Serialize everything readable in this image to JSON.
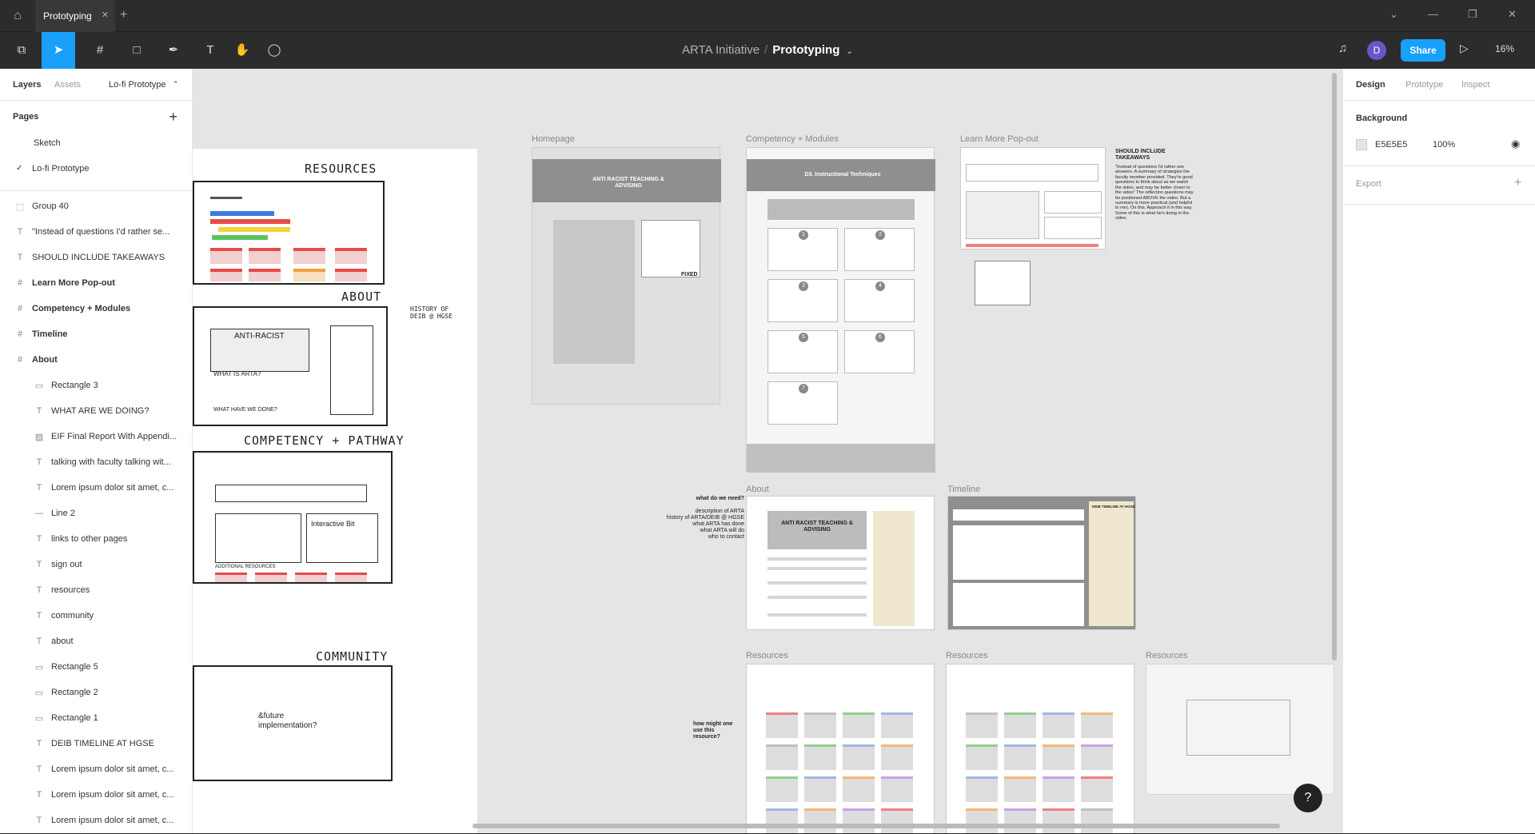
{
  "titlebar": {
    "tab_label": "Prototyping"
  },
  "toolbar": {
    "project": "ARTA Initiative",
    "separator": "/",
    "page": "Prototyping",
    "avatar_initial": "D",
    "share_label": "Share",
    "zoom": "16%"
  },
  "left": {
    "tabs": [
      "Layers",
      "Assets",
      "Lo-fi Prototype"
    ],
    "pages_title": "Pages",
    "pages": [
      "Sketch",
      "Lo-fi Prototype"
    ],
    "layers": [
      {
        "label": "Group 40",
        "icon": "group-icon",
        "glyph": "⬚",
        "child": false,
        "bold": false
      },
      {
        "label": "\"Instead of questions I'd rather se...",
        "icon": "text-icon",
        "glyph": "T",
        "child": false,
        "bold": false
      },
      {
        "label": "SHOULD INCLUDE TAKEAWAYS",
        "icon": "text-icon",
        "glyph": "T",
        "child": false,
        "bold": false
      },
      {
        "label": "Learn More Pop-out",
        "icon": "frame-icon",
        "glyph": "#",
        "child": false,
        "bold": true
      },
      {
        "label": "Competency + Modules",
        "icon": "frame-icon",
        "glyph": "#",
        "child": false,
        "bold": true
      },
      {
        "label": "Timeline",
        "icon": "frame-icon",
        "glyph": "#",
        "child": false,
        "bold": true
      },
      {
        "label": "About",
        "icon": "frame-icon",
        "glyph": "#",
        "child": false,
        "bold": true
      },
      {
        "label": "Rectangle 3",
        "icon": "rectangle-icon",
        "glyph": "▭",
        "child": true,
        "bold": false
      },
      {
        "label": "WHAT ARE WE DOING?",
        "icon": "text-icon",
        "glyph": "T",
        "child": true,
        "bold": false
      },
      {
        "label": "EIF Final Report With Appendi...",
        "icon": "image-icon",
        "glyph": "▨",
        "child": true,
        "bold": false
      },
      {
        "label": "talking with faculty talking wit...",
        "icon": "text-icon",
        "glyph": "T",
        "child": true,
        "bold": false
      },
      {
        "label": "Lorem ipsum dolor sit amet, c...",
        "icon": "text-icon",
        "glyph": "T",
        "child": true,
        "bold": false
      },
      {
        "label": "Line 2",
        "icon": "line-icon",
        "glyph": "—",
        "child": true,
        "bold": false
      },
      {
        "label": "links to other pages",
        "icon": "text-icon",
        "glyph": "T",
        "child": true,
        "bold": false
      },
      {
        "label": "sign out",
        "icon": "text-icon",
        "glyph": "T",
        "child": true,
        "bold": false
      },
      {
        "label": "resources",
        "icon": "text-icon",
        "glyph": "T",
        "child": true,
        "bold": false
      },
      {
        "label": "community",
        "icon": "text-icon",
        "glyph": "T",
        "child": true,
        "bold": false
      },
      {
        "label": "about",
        "icon": "text-icon",
        "glyph": "T",
        "child": true,
        "bold": false
      },
      {
        "label": "Rectangle 5",
        "icon": "rectangle-icon",
        "glyph": "▭",
        "child": true,
        "bold": false
      },
      {
        "label": "Rectangle 2",
        "icon": "rectangle-icon",
        "glyph": "▭",
        "child": true,
        "bold": false
      },
      {
        "label": "Rectangle 1",
        "icon": "rectangle-icon",
        "glyph": "▭",
        "child": true,
        "bold": false
      },
      {
        "label": "DEIB TIMELINE AT HGSE",
        "icon": "text-icon",
        "glyph": "T",
        "child": true,
        "bold": false
      },
      {
        "label": "Lorem ipsum dolor sit amet, c...",
        "icon": "text-icon",
        "glyph": "T",
        "child": true,
        "bold": false
      },
      {
        "label": "Lorem ipsum dolor sit amet, c...",
        "icon": "text-icon",
        "glyph": "T",
        "child": true,
        "bold": false
      },
      {
        "label": "Lorem ipsum dolor sit amet, c...",
        "icon": "text-icon",
        "glyph": "T",
        "child": true,
        "bold": false
      }
    ]
  },
  "canvas": {
    "sketch_titles": [
      "RESOURCES",
      "ABOUT",
      "COMPETENCY + PATHWAY",
      "COMMUNITY"
    ],
    "sketch_notes": {
      "history": "HISTORY OF DEIB @ HGSE",
      "future": "&future implementation?",
      "interactive": "Interactive Bit",
      "anti_racist": "ANTI-RACIST",
      "what_is_arta": "WHAT IS ARTA?",
      "what_have_we_done": "WHAT HAVE WE DONE?",
      "additional_resources": "ADDITIONAL RESOURCES"
    },
    "frame_labels": {
      "homepage": "Homepage",
      "competency": "Competency + Modules",
      "learn_more": "Learn More Pop-out",
      "about": "About",
      "timeline": "Timeline",
      "resources1": "Resources",
      "resources2": "Resources",
      "resources3": "Resources"
    },
    "homepage_banner": "ANTI RACIST TEACHING & ADVISING",
    "homepage_fixed": "FIXED",
    "competency_banner": "D3. Instructional Techniques",
    "module_numbers": [
      "1",
      "2",
      "3",
      "4",
      "5",
      "6",
      "7"
    ],
    "about_banner": "ANTI RACIST TEACHING & ADVISING",
    "timeline_heading": "DEIB TIMELINE AT HGSE",
    "takeaways_title": "SHOULD INCLUDE TAKEAWAYS",
    "takeaways_body": "\"Instead of questions I'd rather see answers. A summary of strategies the faculty member provided. They're good questions to think about as we watch the video, and may be better closer to the video\" The reflection questions may be positioned ABOVE the video. But a summary is more practical (and helpful to me). On this. Approach it in this way. Some of this is what he's doing in the video.",
    "about_note_title": "what do we need?",
    "about_note_body": "description of ARTA\nhistory of ARTA/DEIB @ HGSE\nwhat ARTA has done\nwhat ARTA will do\nwho to contact",
    "resources_note": "how might one use this resource?"
  },
  "right": {
    "tabs": [
      "Design",
      "Prototype",
      "Inspect"
    ],
    "background_title": "Background",
    "background_hex": "E5E5E5",
    "background_opacity": "100%",
    "export_title": "Export"
  },
  "colors": {
    "accent": "#18a0fb",
    "canvas": "#e5e5e5",
    "avatar": "#6a56c9"
  }
}
